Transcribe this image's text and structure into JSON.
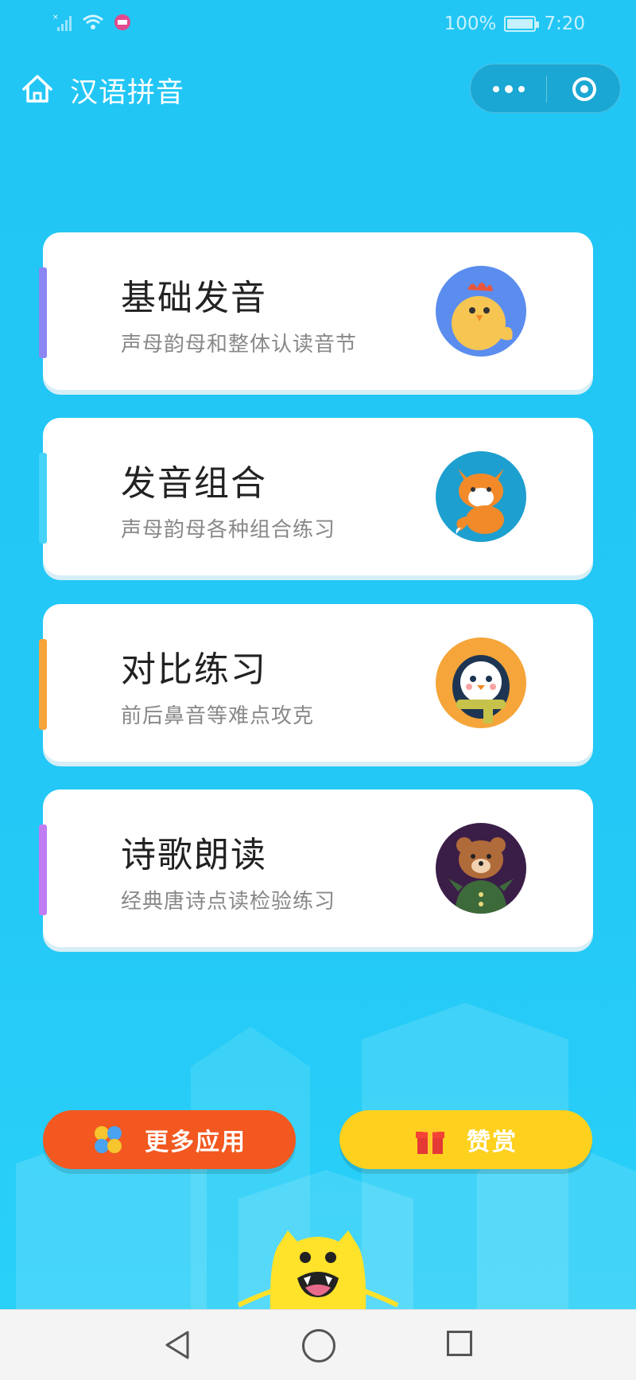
{
  "status_bar": {
    "battery": "100%",
    "time": "7:20",
    "battery_level": 1.0,
    "icons": [
      "no-signal-icon",
      "wifi-icon",
      "sale-badge-icon"
    ]
  },
  "header": {
    "title": "汉语拼音",
    "home_icon": "home-icon",
    "more_icon": "more-dots-icon",
    "close_icon": "target-icon"
  },
  "cards": [
    {
      "title": "基础发音",
      "subtitle": "声母韵母和整体认读音节",
      "accent": "#8b86f2",
      "avatar": "chick-icon",
      "avatar_bg": "#5b8def"
    },
    {
      "title": "发音组合",
      "subtitle": "声母韵母各种组合练习",
      "accent": "#46d3f7",
      "avatar": "fox-icon",
      "avatar_bg": "#1d9fcf"
    },
    {
      "title": "对比练习",
      "subtitle": "前后鼻音等难点攻克",
      "accent": "#f5a53a",
      "avatar": "penguin-icon",
      "avatar_bg": "#f5a53a"
    },
    {
      "title": "诗歌朗读",
      "subtitle": "经典唐诗点读检验练习",
      "accent": "#c27cf2",
      "avatar": "bear-icon",
      "avatar_bg": "#3b1e48"
    }
  ],
  "buttons": {
    "more_apps": "更多应用",
    "reward": "赞赏",
    "more_apps_color": "#f2581f",
    "reward_color": "#fdd11e"
  },
  "colors": {
    "background": "#22c6f5",
    "card": "#ffffff"
  }
}
